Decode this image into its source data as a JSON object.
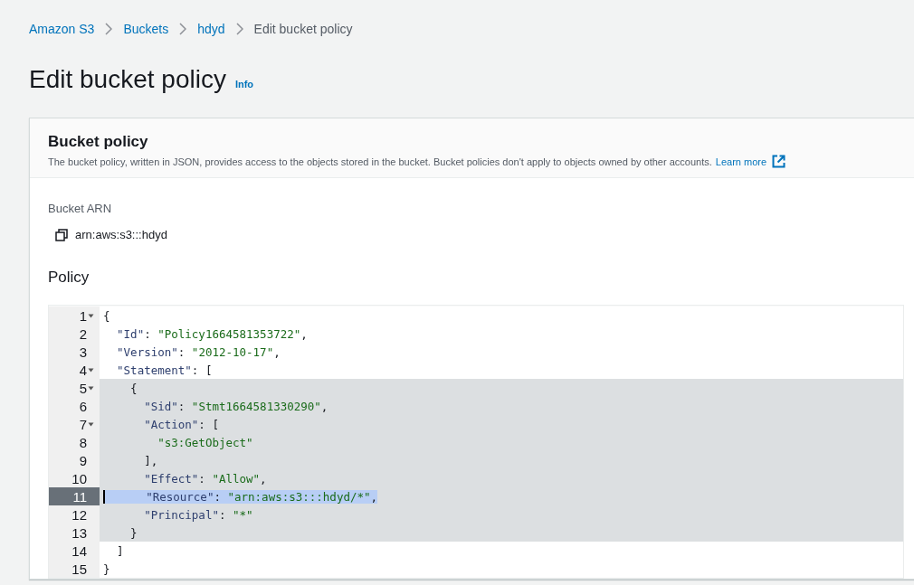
{
  "breadcrumbs": [
    {
      "label": "Amazon S3",
      "link": true
    },
    {
      "label": "Buckets",
      "link": true
    },
    {
      "label": "hdyd",
      "link": true
    },
    {
      "label": "Edit bucket policy",
      "link": false
    }
  ],
  "page": {
    "title": "Edit bucket policy",
    "info_link": "Info"
  },
  "card": {
    "title": "Bucket policy",
    "description": "The bucket policy, written in JSON, provides access to the objects stored in the bucket. Bucket policies don't apply to objects owned by other accounts.",
    "learn_more": "Learn more",
    "arn_label": "Bucket ARN",
    "arn_value": "arn:aws:s3:::hdyd",
    "policy_label": "Policy"
  },
  "editor": {
    "lines": [
      {
        "number": "1",
        "foldable": true,
        "in_scope": false,
        "selected": false,
        "tokens": [
          {
            "kind": "punct",
            "text": "{"
          }
        ]
      },
      {
        "number": "2",
        "foldable": false,
        "in_scope": false,
        "selected": false,
        "tokens": [
          {
            "kind": "key",
            "text": "  \"Id\""
          },
          {
            "kind": "punct",
            "text": ": "
          },
          {
            "kind": "string",
            "text": "\"Policy1664581353722\""
          },
          {
            "kind": "punct",
            "text": ","
          }
        ]
      },
      {
        "number": "3",
        "foldable": false,
        "in_scope": false,
        "selected": false,
        "tokens": [
          {
            "kind": "key",
            "text": "  \"Version\""
          },
          {
            "kind": "punct",
            "text": ": "
          },
          {
            "kind": "string",
            "text": "\"2012-10-17\""
          },
          {
            "kind": "punct",
            "text": ","
          }
        ]
      },
      {
        "number": "4",
        "foldable": true,
        "in_scope": false,
        "selected": false,
        "tokens": [
          {
            "kind": "key",
            "text": "  \"Statement\""
          },
          {
            "kind": "punct",
            "text": ": ["
          }
        ]
      },
      {
        "number": "5",
        "foldable": true,
        "in_scope": true,
        "selected": false,
        "tokens": [
          {
            "kind": "punct",
            "text": "    {"
          }
        ]
      },
      {
        "number": "6",
        "foldable": false,
        "in_scope": true,
        "selected": false,
        "tokens": [
          {
            "kind": "key",
            "text": "      \"Sid\""
          },
          {
            "kind": "punct",
            "text": ": "
          },
          {
            "kind": "string",
            "text": "\"Stmt1664581330290\""
          },
          {
            "kind": "punct",
            "text": ","
          }
        ]
      },
      {
        "number": "7",
        "foldable": true,
        "in_scope": true,
        "selected": false,
        "tokens": [
          {
            "kind": "key",
            "text": "      \"Action\""
          },
          {
            "kind": "punct",
            "text": ": ["
          }
        ]
      },
      {
        "number": "8",
        "foldable": false,
        "in_scope": true,
        "selected": false,
        "tokens": [
          {
            "kind": "string",
            "text": "        \"s3:GetObject\""
          }
        ]
      },
      {
        "number": "9",
        "foldable": false,
        "in_scope": true,
        "selected": false,
        "tokens": [
          {
            "kind": "punct",
            "text": "      ],"
          }
        ]
      },
      {
        "number": "10",
        "foldable": false,
        "in_scope": true,
        "selected": false,
        "tokens": [
          {
            "kind": "key",
            "text": "      \"Effect\""
          },
          {
            "kind": "punct",
            "text": ": "
          },
          {
            "kind": "string",
            "text": "\"Allow\""
          },
          {
            "kind": "punct",
            "text": ","
          }
        ]
      },
      {
        "number": "11",
        "foldable": false,
        "in_scope": true,
        "selected": true,
        "tokens": [
          {
            "kind": "key",
            "text": "      \"Resource\""
          },
          {
            "kind": "punct",
            "text": ": "
          },
          {
            "kind": "string",
            "text": "\"arn:aws:s3:::hdyd/*\""
          },
          {
            "kind": "punct",
            "text": ","
          }
        ]
      },
      {
        "number": "12",
        "foldable": false,
        "in_scope": true,
        "selected": false,
        "tokens": [
          {
            "kind": "key",
            "text": "      \"Principal\""
          },
          {
            "kind": "punct",
            "text": ": "
          },
          {
            "kind": "string",
            "text": "\"*\""
          }
        ]
      },
      {
        "number": "13",
        "foldable": false,
        "in_scope": true,
        "selected": false,
        "tokens": [
          {
            "kind": "punct",
            "text": "    }"
          }
        ]
      },
      {
        "number": "14",
        "foldable": false,
        "in_scope": false,
        "selected": false,
        "tokens": [
          {
            "kind": "punct",
            "text": "  ]"
          }
        ]
      },
      {
        "number": "15",
        "foldable": false,
        "in_scope": false,
        "selected": false,
        "tokens": [
          {
            "kind": "punct",
            "text": "}"
          }
        ]
      }
    ]
  }
}
